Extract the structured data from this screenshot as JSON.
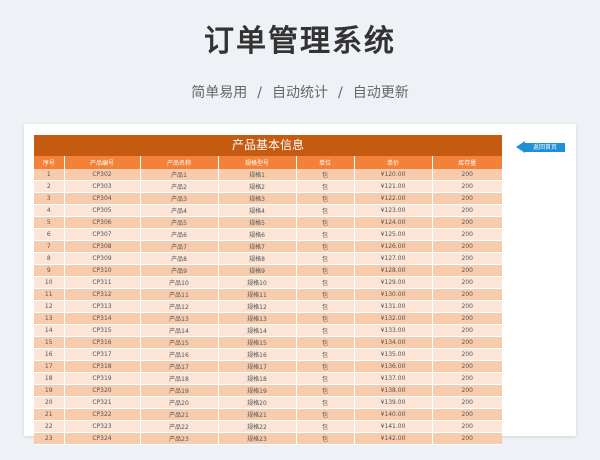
{
  "header": {
    "title": "订单管理系统",
    "subtitle_parts": [
      "简单易用",
      "自动统计",
      "自动更新"
    ],
    "separator": "/"
  },
  "table": {
    "title": "产品基本信息",
    "columns": [
      "序号",
      "产品编号",
      "产品名称",
      "规格型号",
      "单位",
      "单价",
      "库存量"
    ],
    "rows": [
      [
        "1",
        "CP302",
        "产品1",
        "规格1",
        "包",
        "¥120.00",
        "200"
      ],
      [
        "2",
        "CP303",
        "产品2",
        "规格2",
        "包",
        "¥121.00",
        "200"
      ],
      [
        "3",
        "CP304",
        "产品3",
        "规格3",
        "包",
        "¥122.00",
        "200"
      ],
      [
        "4",
        "CP305",
        "产品4",
        "规格4",
        "包",
        "¥123.00",
        "200"
      ],
      [
        "5",
        "CP306",
        "产品5",
        "规格5",
        "包",
        "¥124.00",
        "200"
      ],
      [
        "6",
        "CP307",
        "产品6",
        "规格6",
        "包",
        "¥125.00",
        "200"
      ],
      [
        "7",
        "CP308",
        "产品7",
        "规格7",
        "包",
        "¥126.00",
        "200"
      ],
      [
        "8",
        "CP309",
        "产品8",
        "规格8",
        "包",
        "¥127.00",
        "200"
      ],
      [
        "9",
        "CP310",
        "产品9",
        "规格9",
        "包",
        "¥128.00",
        "200"
      ],
      [
        "10",
        "CP311",
        "产品10",
        "规格10",
        "包",
        "¥129.00",
        "200"
      ],
      [
        "11",
        "CP312",
        "产品11",
        "规格11",
        "包",
        "¥130.00",
        "200"
      ],
      [
        "12",
        "CP313",
        "产品12",
        "规格12",
        "包",
        "¥131.00",
        "200"
      ],
      [
        "13",
        "CP314",
        "产品13",
        "规格13",
        "包",
        "¥132.00",
        "200"
      ],
      [
        "14",
        "CP315",
        "产品14",
        "规格14",
        "包",
        "¥133.00",
        "200"
      ],
      [
        "15",
        "CP316",
        "产品15",
        "规格15",
        "包",
        "¥134.00",
        "200"
      ],
      [
        "16",
        "CP317",
        "产品16",
        "规格16",
        "包",
        "¥135.00",
        "200"
      ],
      [
        "17",
        "CP318",
        "产品17",
        "规格17",
        "包",
        "¥136.00",
        "200"
      ],
      [
        "18",
        "CP319",
        "产品18",
        "规格18",
        "包",
        "¥137.00",
        "200"
      ],
      [
        "19",
        "CP320",
        "产品19",
        "规格19",
        "包",
        "¥138.00",
        "200"
      ],
      [
        "20",
        "CP321",
        "产品20",
        "规格20",
        "包",
        "¥139.00",
        "200"
      ],
      [
        "21",
        "CP322",
        "产品21",
        "规格21",
        "包",
        "¥140.00",
        "200"
      ],
      [
        "22",
        "CP323",
        "产品22",
        "规格22",
        "包",
        "¥141.00",
        "200"
      ],
      [
        "23",
        "CP324",
        "产品23",
        "规格23",
        "包",
        "¥142.00",
        "200"
      ]
    ]
  },
  "home_button": {
    "label": "返回首页",
    "icon": "arrow-left-icon"
  },
  "colors": {
    "title_bar": "#c55a11",
    "header_row": "#f4813a",
    "row_odd": "#f8cbad",
    "row_even": "#fce4d6",
    "home_button": "#1e90d8"
  }
}
